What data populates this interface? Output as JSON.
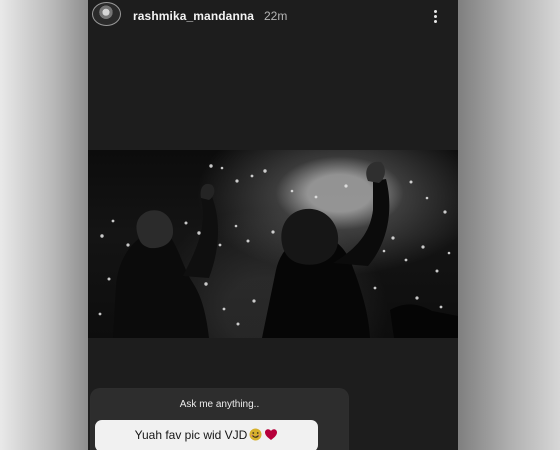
{
  "story": {
    "username": "rashmika_mandanna",
    "time": "22m",
    "question_prompt": "Ask me anything..",
    "answer_text": "Yuah fav pic wid VJD",
    "colors": {
      "story_background": "#1d1d1d",
      "username": "#f4f4f4",
      "heart": "#b7003b",
      "emoji": "#d7b12c"
    },
    "icons": {
      "menu": "three-dots-icon",
      "avatar": "profile-photo",
      "emoji": "smiling-face-icon",
      "heart": "red-heart-icon"
    }
  }
}
